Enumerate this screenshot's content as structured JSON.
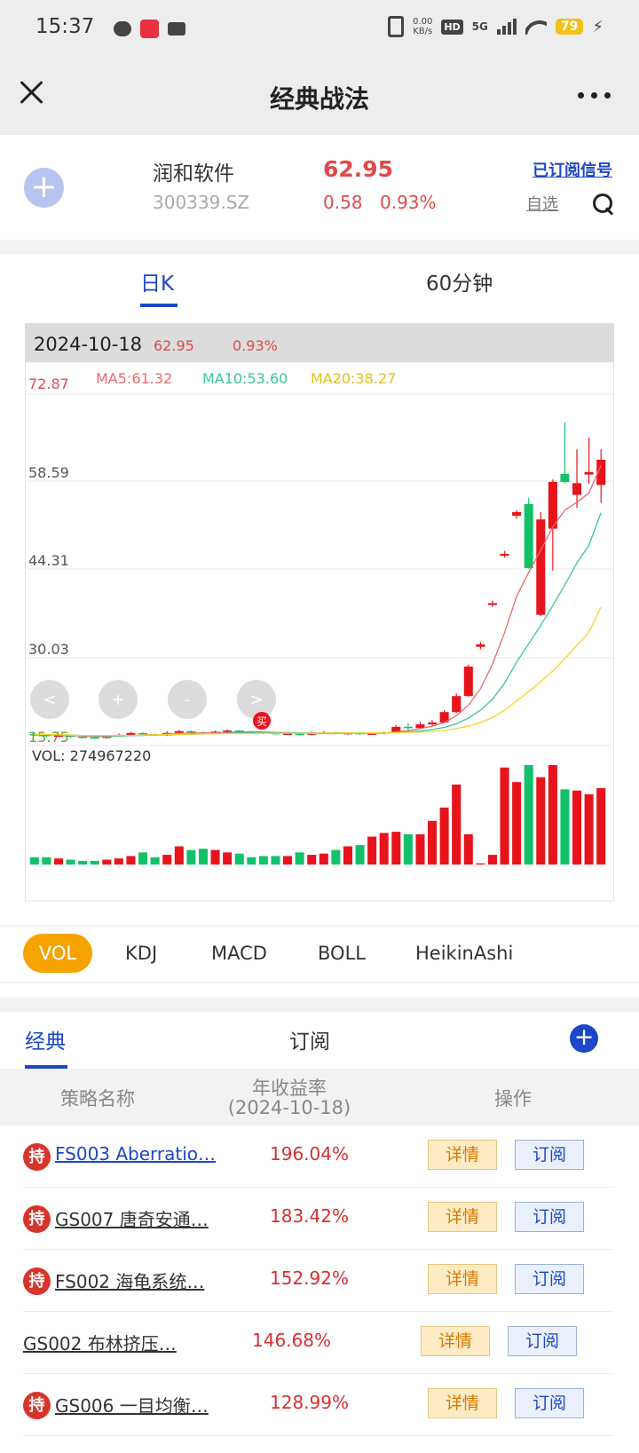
{
  "status_bar": {
    "time": "15:37",
    "net_speed_value": "0.00",
    "net_speed_unit": "KB/s",
    "hd": "HD",
    "network": "5G",
    "battery": "79"
  },
  "nav": {
    "title": "经典战法"
  },
  "stock": {
    "name": "润和软件",
    "code": "300339.SZ",
    "price": "62.95",
    "change": "0.58",
    "change_pct": "0.93%",
    "subscribed_label": "已订阅信号",
    "watchlist_label": "自选"
  },
  "period_tabs": [
    "日K",
    "60分钟"
  ],
  "chart_info": {
    "date": "2024-10-18",
    "price": "62.95",
    "pct": "0.93%",
    "ma5": "MA5:61.32",
    "ma10": "MA10:53.60",
    "ma20": "MA20:38.27",
    "y_labels": [
      "72.87",
      "58.59",
      "44.31",
      "30.03",
      "15.75"
    ],
    "vol_label": "VOL: 274967220",
    "buy_mark": "买",
    "controls": [
      "<",
      "+",
      "-",
      ">"
    ]
  },
  "chart_data": {
    "type": "candlestick",
    "ylim": [
      15.75,
      72.87
    ],
    "candles": [
      [
        17.6,
        17.5,
        17.9,
        17.3
      ],
      [
        17.5,
        17.3,
        17.6,
        17.1
      ],
      [
        17.3,
        17.4,
        17.6,
        17.2
      ],
      [
        17.4,
        17.2,
        17.5,
        17.0
      ],
      [
        17.2,
        17.1,
        17.3,
        16.9
      ],
      [
        17.1,
        17.0,
        17.2,
        16.8
      ],
      [
        17.0,
        17.3,
        17.5,
        16.9
      ],
      [
        17.3,
        17.5,
        17.7,
        17.2
      ],
      [
        17.5,
        17.8,
        18.0,
        17.4
      ],
      [
        17.8,
        17.6,
        17.9,
        17.4
      ],
      [
        17.6,
        17.4,
        17.7,
        17.3
      ],
      [
        17.4,
        17.8,
        18.1,
        17.3
      ],
      [
        17.8,
        18.1,
        18.3,
        17.7
      ],
      [
        18.1,
        17.9,
        18.2,
        17.7
      ],
      [
        17.9,
        17.7,
        18.0,
        17.5
      ],
      [
        17.7,
        18.0,
        18.2,
        17.6
      ],
      [
        18.0,
        18.2,
        18.4,
        17.9
      ],
      [
        18.2,
        18.0,
        18.3,
        17.9
      ],
      [
        18.0,
        17.9,
        18.1,
        17.8
      ],
      [
        17.9,
        17.8,
        18.0,
        17.6
      ],
      [
        17.8,
        17.6,
        17.9,
        17.5
      ],
      [
        17.6,
        17.7,
        17.9,
        17.5
      ],
      [
        17.7,
        17.5,
        17.8,
        17.3
      ],
      [
        17.5,
        17.8,
        18.0,
        17.4
      ],
      [
        17.8,
        17.9,
        18.1,
        17.7
      ],
      [
        17.9,
        17.7,
        18.0,
        17.6
      ],
      [
        17.7,
        17.8,
        17.9,
        17.5
      ],
      [
        17.8,
        17.6,
        17.9,
        17.5
      ],
      [
        17.6,
        17.7,
        17.8,
        17.5
      ],
      [
        17.7,
        17.9,
        18.0,
        17.6
      ],
      [
        17.9,
        18.8,
        19.1,
        17.8
      ],
      [
        18.8,
        18.6,
        19.4,
        18.3
      ],
      [
        18.6,
        19.2,
        19.6,
        18.5
      ],
      [
        19.2,
        19.5,
        19.9,
        19.0
      ],
      [
        19.5,
        21.2,
        21.5,
        19.4
      ],
      [
        21.2,
        23.8,
        24.2,
        21.0
      ],
      [
        23.8,
        28.6,
        28.9,
        23.7
      ],
      [
        31.8,
        32.2,
        32.6,
        31.4
      ],
      [
        38.6,
        38.9,
        39.3,
        38.3
      ],
      [
        46.6,
        46.9,
        47.4,
        46.3
      ],
      [
        53.1,
        53.7,
        54.0,
        52.6
      ],
      [
        55.0,
        44.6,
        56.0,
        44.5
      ],
      [
        37.0,
        52.5,
        53.7,
        36.8
      ],
      [
        51.0,
        58.6,
        59.0,
        44.2
      ],
      [
        59.9,
        58.6,
        68.3,
        58.4
      ],
      [
        56.5,
        58.4,
        63.9,
        54.4
      ],
      [
        59.8,
        60.2,
        65.8,
        58.3
      ],
      [
        58.1,
        62.2,
        63.9,
        55.2
      ]
    ],
    "ma5": [
      17.6,
      17.5,
      17.45,
      17.4,
      17.3,
      17.2,
      17.2,
      17.3,
      17.4,
      17.5,
      17.5,
      17.6,
      17.7,
      17.8,
      17.8,
      17.8,
      17.9,
      17.95,
      18.0,
      17.95,
      17.9,
      17.8,
      17.75,
      17.7,
      17.7,
      17.7,
      17.75,
      17.75,
      17.7,
      17.75,
      17.95,
      18.2,
      18.5,
      18.9,
      19.5,
      20.6,
      22.3,
      25.0,
      29.0,
      34.1,
      40.0,
      43.9,
      47.5,
      51.3,
      54.0,
      55.3,
      56.8,
      61.3
    ],
    "ma10": [
      17.6,
      17.55,
      17.5,
      17.45,
      17.4,
      17.35,
      17.3,
      17.3,
      17.35,
      17.4,
      17.45,
      17.5,
      17.55,
      17.6,
      17.65,
      17.7,
      17.75,
      17.8,
      17.85,
      17.85,
      17.85,
      17.85,
      17.8,
      17.8,
      17.8,
      17.8,
      17.8,
      17.8,
      17.75,
      17.8,
      17.9,
      18.0,
      18.15,
      18.35,
      18.7,
      19.3,
      20.2,
      21.5,
      23.3,
      25.9,
      29.3,
      32.3,
      35.3,
      38.5,
      41.9,
      45.4,
      48.3,
      53.6
    ],
    "ma20": [
      17.6,
      17.55,
      17.5,
      17.45,
      17.4,
      17.4,
      17.4,
      17.4,
      17.4,
      17.45,
      17.5,
      17.55,
      17.6,
      17.6,
      17.65,
      17.65,
      17.7,
      17.7,
      17.7,
      17.75,
      17.75,
      17.75,
      17.75,
      17.75,
      17.8,
      17.8,
      17.8,
      17.8,
      17.8,
      17.8,
      17.85,
      17.9,
      17.95,
      18.05,
      18.2,
      18.5,
      18.9,
      19.5,
      20.3,
      21.5,
      23.0,
      24.5,
      26.1,
      27.9,
      29.9,
      32.0,
      34.2,
      38.27
    ],
    "volume": [
      6,
      6,
      5,
      4,
      3,
      3,
      4,
      5,
      7,
      10,
      6,
      8,
      15,
      12,
      13,
      12,
      10,
      9,
      6,
      7,
      7,
      7,
      10,
      8,
      9,
      12,
      15,
      16,
      23,
      26,
      27,
      25,
      25,
      36,
      47,
      66,
      25,
      1,
      8,
      80,
      68,
      82,
      72,
      82,
      62,
      61,
      58,
      63
    ],
    "vol_max": 82
  },
  "indicator_tabs": [
    "VOL",
    "KDJ",
    "MACD",
    "BOLL",
    "HeikinAshi"
  ],
  "strategy_tabs": [
    "经典",
    "订阅"
  ],
  "table": {
    "headers": {
      "name": "策略名称",
      "rate": "年收益率",
      "rate_date": "(2024-10-18)",
      "action": "操作"
    },
    "held_badge": "持",
    "detail_label": "详情",
    "subscribe_label": "订阅",
    "rows": [
      {
        "name": "FS003 Aberratio…",
        "rate": "196.04%"
      },
      {
        "name": "GS007 唐奇安通…",
        "rate": "183.42%"
      },
      {
        "name": "FS002 海龟系统…",
        "rate": "152.92%"
      },
      {
        "name": "GS002 布林挤压…",
        "rate": "146.68%"
      },
      {
        "name": "GS006 一目均衡…",
        "rate": "128.99%"
      }
    ]
  },
  "colors": {
    "accent_blue": "#1b47c8",
    "up_red": "#e8141c",
    "down_green": "#13c16b",
    "ma5": "#e86a6a",
    "ma10": "#3cc59a",
    "ma20": "#f2d42a",
    "vol_tab_active": "#f6a300"
  }
}
